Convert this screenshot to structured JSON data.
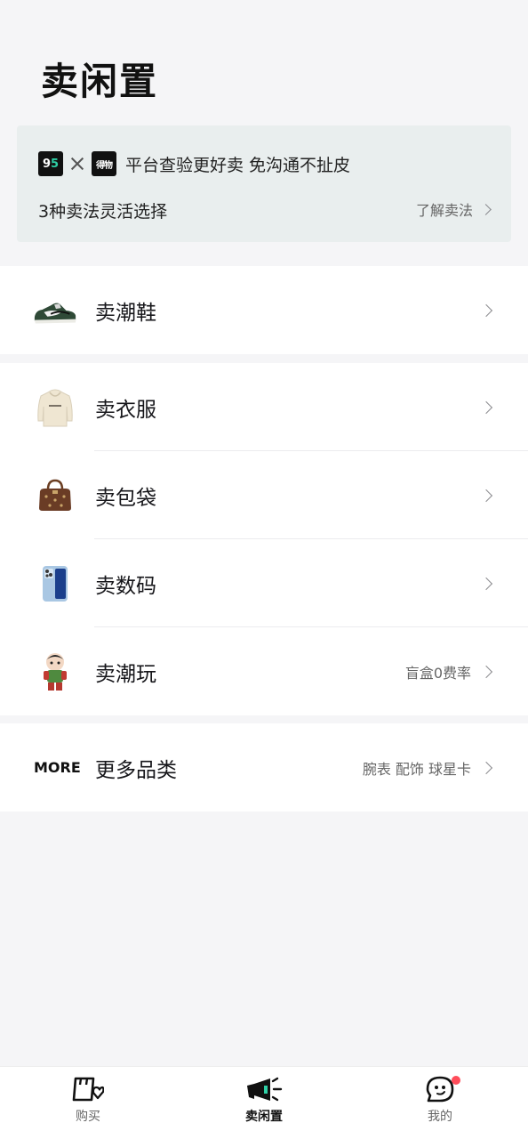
{
  "header": {
    "title": "卖闲置"
  },
  "banner": {
    "logo_left": "95",
    "logo_right": "得物",
    "headline": "平台查验更好卖 免沟通不扯皮",
    "subline": "3种卖法灵活选择",
    "link": "了解卖法"
  },
  "categories": {
    "sneakers": {
      "label": "卖潮鞋",
      "icon": "sneaker-icon"
    },
    "clothes": {
      "label": "卖衣服",
      "icon": "hoodie-icon"
    },
    "bags": {
      "label": "卖包袋",
      "icon": "handbag-icon"
    },
    "digital": {
      "label": "卖数码",
      "icon": "phone-icon"
    },
    "toys": {
      "label": "卖潮玩",
      "icon": "figure-icon",
      "note": "盲盒0费率"
    }
  },
  "more": {
    "badge": "MORE",
    "label": "更多品类",
    "note": "腕表 配饰 球星卡"
  },
  "tabbar": {
    "items": [
      {
        "label": "购买",
        "icon": "bag-heart-icon",
        "active": false
      },
      {
        "label": "卖闲置",
        "icon": "megaphone-icon",
        "active": true
      },
      {
        "label": "我的",
        "icon": "chat-face-icon",
        "active": false,
        "badge": true
      }
    ]
  },
  "colors": {
    "background": "#f5f5f7",
    "banner_bg": "#e9eeee",
    "accent_green": "#2fd0a6",
    "badge_red": "#ff4d5a"
  }
}
